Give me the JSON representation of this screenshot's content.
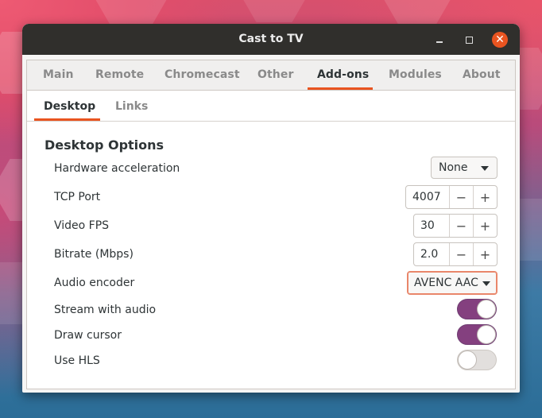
{
  "window": {
    "title": "Cast to TV"
  },
  "tabs": [
    {
      "label": "Main",
      "active": false
    },
    {
      "label": "Remote",
      "active": false
    },
    {
      "label": "Chromecast",
      "active": false
    },
    {
      "label": "Other",
      "active": false
    },
    {
      "label": "Add-ons",
      "active": true
    },
    {
      "label": "Modules",
      "active": false
    },
    {
      "label": "About",
      "active": false
    }
  ],
  "subtabs": [
    {
      "label": "Desktop",
      "active": true
    },
    {
      "label": "Links",
      "active": false
    }
  ],
  "desktop": {
    "heading": "Desktop Options",
    "hardware_acceleration": {
      "label": "Hardware acceleration",
      "value": "None"
    },
    "tcp_port": {
      "label": "TCP Port",
      "value": "4007"
    },
    "video_fps": {
      "label": "Video FPS",
      "value": "30"
    },
    "bitrate": {
      "label": "Bitrate (Mbps)",
      "value": "2.0"
    },
    "audio_encoder": {
      "label": "Audio encoder",
      "value": "AVENC AAC"
    },
    "stream_with_audio": {
      "label": "Stream with audio",
      "on": true
    },
    "draw_cursor": {
      "label": "Draw cursor",
      "on": true
    },
    "use_hls": {
      "label": "Use HLS",
      "on": false
    }
  },
  "spin": {
    "minus": "−",
    "plus": "+"
  },
  "icons": {
    "minimize": "minimize-icon",
    "maximize": "maximize-icon",
    "close": "close-icon",
    "dropdown": "chevron-down-icon"
  },
  "colors": {
    "accent": "#e95420",
    "switch_on": "#84407f",
    "titlebar": "#302f2c"
  }
}
